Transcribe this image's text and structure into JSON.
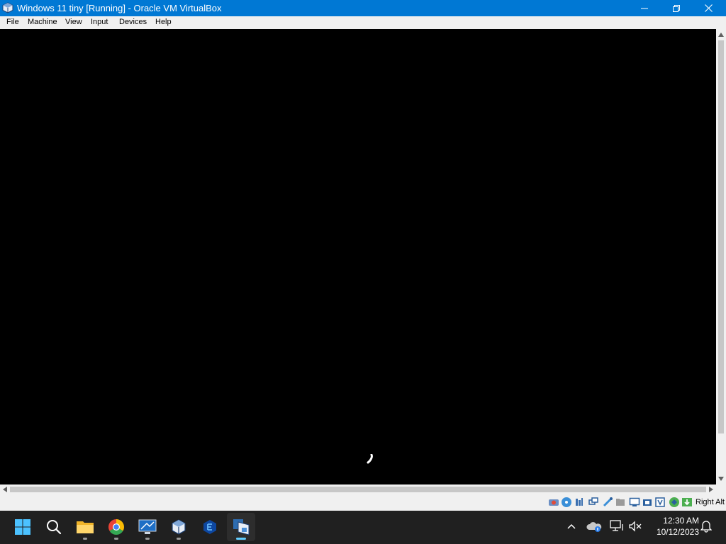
{
  "window": {
    "title": "Windows 11 tiny [Running] - Oracle VM VirtualBox",
    "icon": "virtualbox-icon"
  },
  "menu": [
    "File",
    "Machine",
    "View",
    "Input",
    "Devices",
    "Help"
  ],
  "statusbar": {
    "icons": [
      "hard-disk-icon",
      "optical-drive-icon",
      "audio-icon",
      "network-icon",
      "usb-icon",
      "shared-folders-icon",
      "display-icon",
      "recording-icon",
      "virtualization-icon",
      "mouse-integration-icon",
      "keyboard-icon"
    ],
    "host_key": "Right Alt"
  },
  "taskbar": {
    "apps": [
      "start-icon",
      "search-icon",
      "file-explorer-icon",
      "chrome-icon",
      "remote-desktop-icon",
      "virtualbox-manager-icon",
      "vmware-icon",
      "virtualbox-vm-icon"
    ],
    "active_app": "virtualbox-vm-icon",
    "tray_icons": [
      "chevron-up-icon",
      "onedrive-icon",
      "network-icon",
      "volume-muted-icon",
      "notification-bell-icon"
    ],
    "time": "12:30 AM",
    "date": "10/12/2023"
  },
  "colors": {
    "titlebar": "#0078d4",
    "vm_screen": "#000000",
    "taskbar": "#202020",
    "accent": "#60cdff"
  }
}
